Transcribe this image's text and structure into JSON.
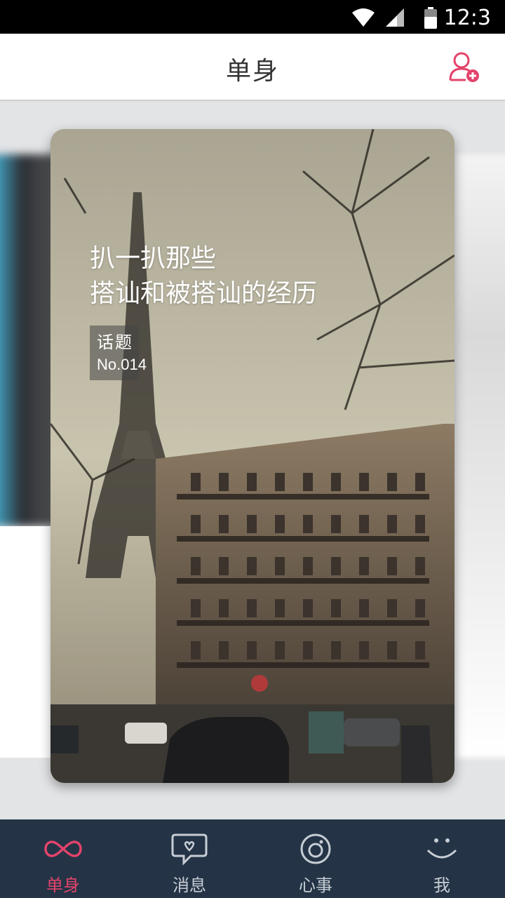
{
  "status_bar": {
    "time": "12:3"
  },
  "header": {
    "title": "单身"
  },
  "topic": {
    "title_line1": "扒一扒那些",
    "title_line2": "搭讪和被搭讪的经历",
    "badge_label": "话题",
    "badge_number": "No.014"
  },
  "nav": {
    "items": [
      {
        "label": "单身",
        "icon": "infinity-icon",
        "active": true
      },
      {
        "label": "消息",
        "icon": "chat-bubble-icon",
        "active": false
      },
      {
        "label": "心事",
        "icon": "target-icon",
        "active": false
      },
      {
        "label": "我",
        "icon": "smile-icon",
        "active": false
      }
    ]
  },
  "colors": {
    "accent": "#e3436b",
    "nav_background": "#243446",
    "nav_inactive": "#c7cdd4"
  }
}
